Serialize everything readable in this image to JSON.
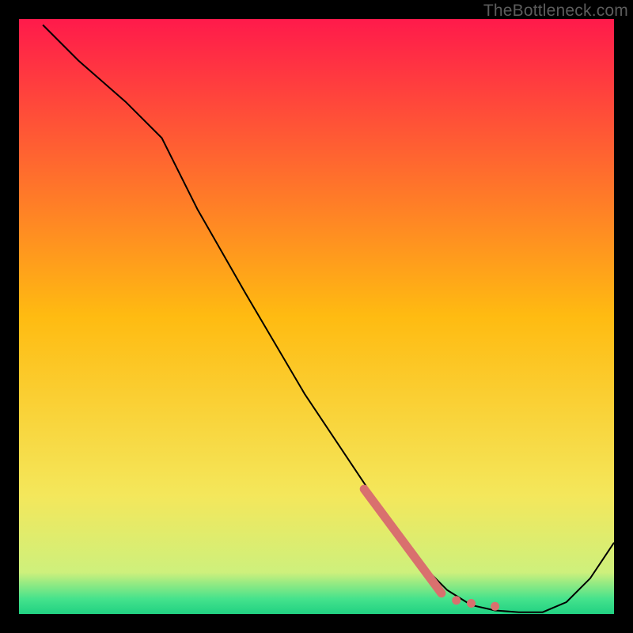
{
  "watermark": "TheBottleneck.com",
  "chart_data": {
    "type": "line",
    "title": "",
    "xlabel": "",
    "ylabel": "",
    "xlim": [
      0,
      100
    ],
    "ylim": [
      0,
      100
    ],
    "grid": false,
    "background_gradient_stops": [
      {
        "pct": 0.0,
        "color": "#ff1a4b"
      },
      {
        "pct": 0.5,
        "color": "#ffbb11"
      },
      {
        "pct": 0.8,
        "color": "#f4e75b"
      },
      {
        "pct": 0.93,
        "color": "#cef07c"
      },
      {
        "pct": 0.975,
        "color": "#44e28c"
      },
      {
        "pct": 1.0,
        "color": "#21d182"
      }
    ],
    "curve": {
      "comment": "main black curve: y as approximate percent of plot height (0=bottom, 100=top) vs x percent",
      "x": [
        4,
        10,
        18,
        24,
        30,
        38,
        48,
        58,
        66,
        72,
        76,
        80,
        84,
        88,
        92,
        96,
        100
      ],
      "y": [
        99,
        93,
        86,
        80,
        68,
        54,
        37,
        22,
        10,
        4,
        1.5,
        0.6,
        0.3,
        0.3,
        2,
        6,
        12
      ]
    },
    "bold_segment": {
      "comment": "coral thick mark along the descent + dotted tail near the trough",
      "color": "#d9706e",
      "line": {
        "x": [
          58,
          71
        ],
        "y": [
          21,
          3.5
        ]
      },
      "dots": [
        {
          "x": 73.5,
          "y": 2.3
        },
        {
          "x": 76,
          "y": 1.8
        },
        {
          "x": 80,
          "y": 1.3
        }
      ]
    }
  }
}
